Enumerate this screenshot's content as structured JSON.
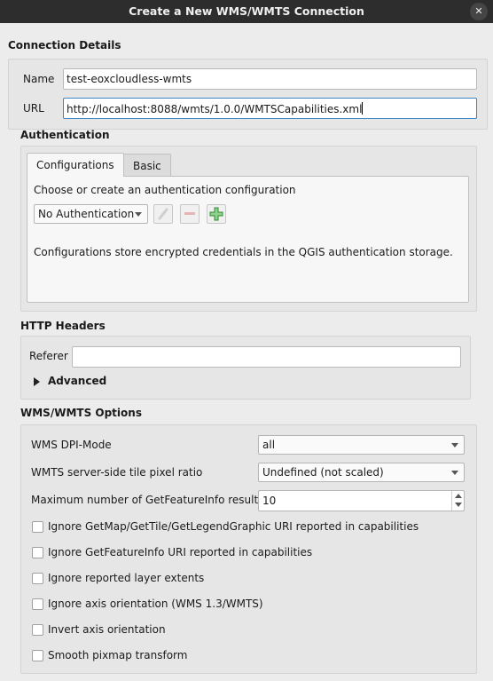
{
  "window": {
    "title": "Create a New WMS/WMTS Connection",
    "close_icon": "✕"
  },
  "connection": {
    "section_title": "Connection Details",
    "name_label": "Name",
    "name_value": "test-eoxcloudless-wmts",
    "url_label": "URL",
    "url_value": "http://localhost:8088/wmts/1.0.0/WMTSCapabilities.xml"
  },
  "authentication": {
    "section_title": "Authentication",
    "tabs": [
      {
        "label": "Configurations",
        "active": true
      },
      {
        "label": "Basic",
        "active": false
      }
    ],
    "prompt": "Choose or create an authentication configuration",
    "selected_config": "No Authentication",
    "info": "Configurations store encrypted credentials in the QGIS authentication storage."
  },
  "http_headers": {
    "section_title": "HTTP Headers",
    "referer_label": "Referer",
    "referer_value": "",
    "advanced_label": "Advanced"
  },
  "options": {
    "section_title": "WMS/WMTS Options",
    "dpi_mode_label": "WMS DPI-Mode",
    "dpi_mode_value": "all",
    "tile_ratio_label": "WMTS server-side tile pixel ratio",
    "tile_ratio_value": "Undefined (not scaled)",
    "max_gfi_label": "Maximum number of GetFeatureInfo results",
    "max_gfi_value": "10",
    "checkboxes": [
      {
        "label": "Ignore GetMap/GetTile/GetLegendGraphic URI reported in capabilities",
        "checked": false
      },
      {
        "label": "Ignore GetFeatureInfo URI reported in capabilities",
        "checked": false
      },
      {
        "label": "Ignore reported layer extents",
        "checked": false
      },
      {
        "label": "Ignore axis orientation (WMS 1.3/WMTS)",
        "checked": false
      },
      {
        "label": "Invert axis orientation",
        "checked": false
      },
      {
        "label": "Smooth pixmap transform",
        "checked": false
      }
    ]
  },
  "colors": {
    "titlebar": "#2d2d2d",
    "focus_border": "#3b86c6",
    "add_icon": "#2e8b2e"
  }
}
